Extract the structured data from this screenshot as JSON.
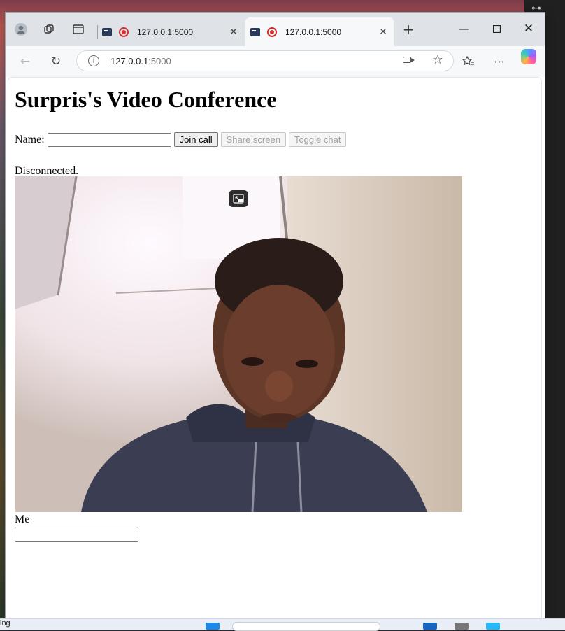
{
  "browser": {
    "tabs": [
      {
        "title": "127.0.0.1:5000",
        "active": false
      },
      {
        "title": "127.0.0.1:5000",
        "active": true
      }
    ],
    "url_host": "127.0.0.1",
    "url_port": ":5000"
  },
  "page": {
    "heading": "Surpris's Video Conference",
    "name_label": "Name:",
    "name_value": "",
    "join_label": "Join call",
    "share_label": "Share screen",
    "toggle_chat_label": "Toggle chat",
    "status": "Disconnected.",
    "video_caption": "Me",
    "chat_value": ""
  },
  "taskbar": {
    "left_text": "ing"
  },
  "colors": {
    "accent_record": "#d32f2f",
    "tab_bg": "#dfe3e8"
  },
  "icons": [
    "profile-icon",
    "workspaces-icon",
    "tab-actions-icon",
    "terminal-icon",
    "record-icon",
    "close-icon",
    "new-tab-icon",
    "minimize-icon",
    "maximize-icon",
    "back-icon",
    "refresh-icon",
    "info-icon",
    "camera-icon",
    "star-icon",
    "favorites-icon",
    "more-icon",
    "copilot-icon",
    "picture-in-picture-icon"
  ]
}
